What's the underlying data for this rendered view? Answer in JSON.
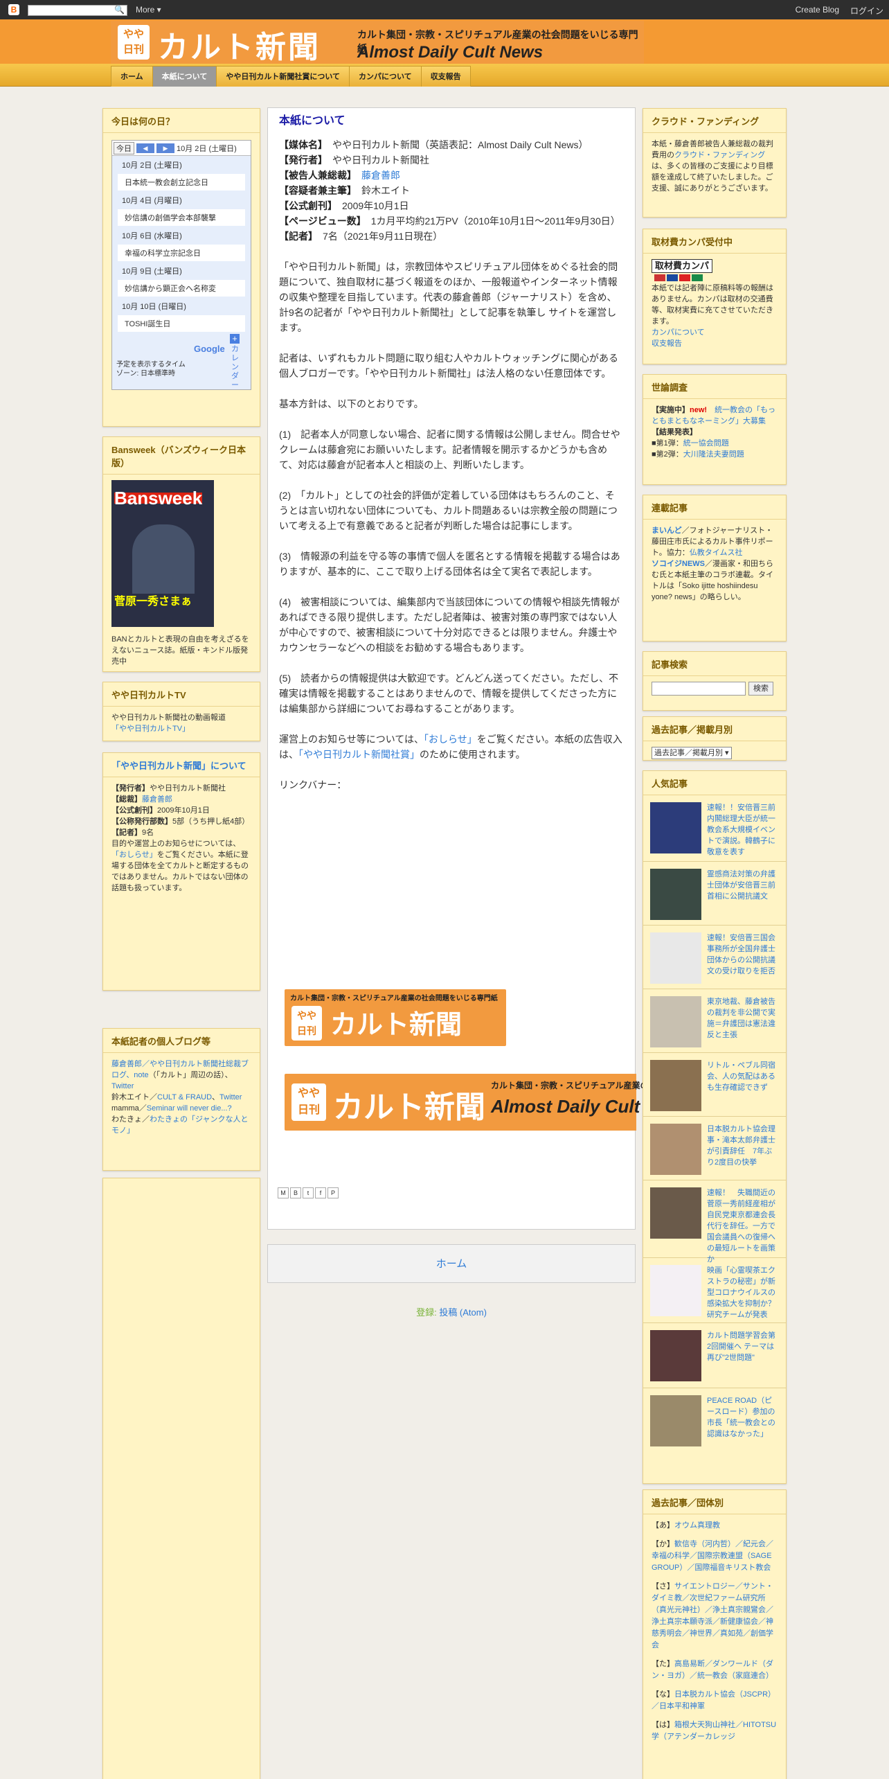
{
  "topbar": {
    "more_label": "More ▾",
    "create_blog": "Create Blog",
    "login": "ログイン"
  },
  "header": {
    "logo_yaya": "やや",
    "logo_nikkan": "日刊",
    "title": "カルト新聞",
    "subtitle": "カルト集団・宗教・スピリチュアル産業の社会問題をいじる専門紙",
    "english": "Almost Daily Cult News"
  },
  "tabs": [
    "ホーム",
    "本紙について",
    "やや日刊カルト新聞社賞について",
    "カンパについて",
    "収支報告"
  ],
  "left": {
    "today": {
      "title": "今日は何の日？",
      "today_btn": "今日",
      "date_label": "10月 2日 (土曜日)",
      "days": [
        {
          "d": "10月 2日 (土曜日)",
          "e": "日本統一教会創立記念日"
        },
        {
          "d": "10月 4日 (月曜日)",
          "e": "妙信講の創価学会本部襲撃"
        },
        {
          "d": "10月 6日 (水曜日)",
          "e": "幸福の科学立宗記念日"
        },
        {
          "d": "10月 9日 (土曜日)",
          "e": "妙信講から顕正会へ名称変"
        },
        {
          "d": "10月 10日 (日曜日)",
          "e": "TOSHI誕生日"
        }
      ],
      "google": "Google",
      "cal_label": "カレンダー",
      "tz1": "予定を表示するタイム",
      "tz2": "ゾーン: 日本標準時"
    },
    "bansweek": {
      "title": "Bansweek（バンズウィーク日本版）",
      "cover_title": "Bansweek",
      "cover_name": "菅原一秀さまぁ",
      "desc": "BANとカルトと表現の自由を考えざるをえないニュース誌。紙版・キンドル版発売中"
    },
    "tv": {
      "title": "やや日刊カルトTV",
      "desc": "やや日刊カルト新聞社の動画報道",
      "link": "「やや日刊カルトTV」"
    },
    "about": {
      "title": "「やや日刊カルト新聞」について",
      "rows": [
        [
          "【発行者】",
          "やや日刊カルト新聞社"
        ],
        [
          "【総裁】",
          "藤倉善郎"
        ],
        [
          "【公式創刊】",
          "2009年10月1日"
        ],
        [
          "【公称発行部数】",
          "5部（うち押し紙4部）"
        ],
        [
          "【記者】",
          "9名"
        ]
      ],
      "text1": "目的や運営上のお知らせについては、",
      "link": "「おしらせ」",
      "text2": "をご覧ください。本紙に登場する団体を全てカルトと断定するものではありません。カルトではない団体の話題も扱っています。"
    },
    "blogs": {
      "title": "本紙記者の個人ブログ等",
      "l1a": "藤倉善郎",
      "l1b": "／やや日刊カルト新聞社総裁ブログ、",
      "l1c": "note",
      "l1d": "（「カルト」周辺の話）、",
      "l1e": "Twitter",
      "l2a": "鈴木エイト／",
      "l2b": "CULT & FRAUD",
      "l2c": "、",
      "l2d": "Twitter",
      "l3a": "mamma／",
      "l3b": "Seminar will never die...?",
      "l4a": "わたきょ／",
      "l4b": "わたきょの「ジャンクな人とモノ」"
    }
  },
  "post": {
    "title": "本紙について",
    "fields": [
      [
        "【媒体名】",
        "やや日刊カルト新聞（英語表記：Almost Daily Cult News）"
      ],
      [
        "【発行者】",
        "やや日刊カルト新聞社"
      ],
      [
        "【被告人兼総裁】",
        "藤倉善郎"
      ],
      [
        "【容疑者兼主筆】",
        "鈴木エイト"
      ],
      [
        "【公式創刊】",
        "2009年10月1日"
      ],
      [
        "【ページビュー数】",
        "1カ月平均約21万PV（2010年10月1日～2011年9月30日）"
      ],
      [
        "【記者】",
        "7名（2021年9月11日現在）"
      ]
    ],
    "p1": "「やや日刊カルト新聞」は，宗教団体やスピリチュアル団体をめぐる社会的問題について、独自取材に基づく報道をのほか、一般報道やインターネット情報の収集や整理を目指しています。代表の藤倉善郎（ジャーナリスト）を含め、計9名の記者が「やや日刊カルト新聞社」として記事を執筆し サイトを運営します。",
    "p2": "記者は、いずれもカルト問題に取り組む人やカルトウォッチングに関心がある個人ブロガーです。「やや日刊カルト新聞社」は法人格のない任意団体です。",
    "p3": "基本方針は、以下のとおりです。",
    "p4": "(1)　記者本人が同意しない場合、記者に関する情報は公開しません。問合せやクレームは藤倉宛にお願いいたします。記者情報を開示するかどうかも含めて、対応は藤倉が記者本人と相談の上、判断いたします。",
    "p5": "(2)　「カルト」としての社会的評価が定着している団体はもちろんのこと、そうとは言い切れない団体についても、カルト問題あるいは宗教全般の問題について考える上で有意義であると記者が判断した場合は記事にします。",
    "p6": "(3)　情報源の利益を守る等の事情で個人を匿名とする情報を掲載する場合はありますが、基本的に、ここで取り上げる団体名は全て実名で表記します。",
    "p7": "(4)　被害相談については、編集部内で当該団体についての情報や相談先情報があればできる限り提供します。ただし記者陣は、被害対策の専門家ではない人が中心ですので、被害相談について十分対応できるとは限りません。弁護士やカウンセラーなどへの相談をお勧めする場合もあります。",
    "p8": "(5)　読者からの情報提供は大歓迎です。どんどん送ってください。ただし、不確実は情報を掲載することはありませんので、情報を提供してくださった方には編集部から詳細についてお尋ねすることがあります。",
    "p9a": "運営上のお知らせ等については、",
    "p9b": "「おしらせ」",
    "p9c": "をご覧ください。本紙の広告収入は、",
    "p9d": "「やや日刊カルト新聞社賞」",
    "p9e": "のために使用されます。",
    "linkbanner": "リンクバナー：",
    "home": "ホーム",
    "subscribe": "登録:",
    "atom": "投稿 (Atom)"
  },
  "right": {
    "cf": {
      "title": "クラウド・ファンディング",
      "t1": "本紙・藤倉善郎被告人兼総裁の裁判費用の",
      "link": "クラウド・ファンディング",
      "t2": "は、多くの皆様のご支援により目標額を達成して終了いたしました。ご支援、誠にありがとうございます。"
    },
    "kanpa": {
      "title": "取材費カンパ受付中",
      "img": "取材費カンパ",
      "t1": "本紙では記者陣に原稿料等の報酬はありません。カンパは取材の交通費等、取材実費に充てさせていただきます。",
      "l1": "カンパについて",
      "l2": "収支報告"
    },
    "poll": {
      "title": "世論調査",
      "now": "【実施中】",
      "new": "new!",
      "nowlink": "統一教会の「もっともまともなネーミング」大募集",
      "res": "【結果発表】",
      "r1a": "■第1弾：",
      "r1b": "統一協会問題",
      "r2a": "■第2弾：",
      "r2b": "大川隆法夫妻問題"
    },
    "serial": {
      "title": "連載記事",
      "a1": "まいんど",
      "a2": "／フォトジャーナリスト・藤田庄市氏によるカルト事件リポート。協力：",
      "a3": "仏教タイムス社",
      "b1": "ソコイジNEWS",
      "b2": "／漫画家・和田ちらむ氏と本紙主筆のコラボ連載。タイトルは「Soko ijitte hoshiindesu yone? news」の略らしい。"
    },
    "search": {
      "title": "記事検索",
      "btn": "検索"
    },
    "archive": {
      "title": "過去記事／掲載月別",
      "select": "過去記事／掲載月別"
    },
    "popular": {
      "title": "人気記事",
      "items": [
        "速報！！安倍晋三前内閣総理大臣が統一教会系大規模イベントで演説。韓鶴子に敬意を表す",
        "霊感商法対策の弁護士団体が安倍晋三前首相に公開抗議文",
        "速報！安倍晋三国会事務所が全国弁護士団体からの公開抗議文の受け取りを拒否",
        "東京地裁、藤倉被告の裁判を非公開で実施＝弁護団は憲法違反と主張",
        "リトル・ペブル同宿会、人の気配はあるも生存確認できず",
        "日本脱カルト協会理事・滝本太郎弁護士が引責辞任　7年ぶり2度目の快挙",
        "速報！　失職間近の菅原一秀前経産相が自民党東京都連会長代行を辞任。一方で国会議員への復帰への最短ルートを画策か",
        "映画「心霊喫茶エクストラの秘密」が新型コロナウイルスの感染拡大を抑制か？　研究チームが発表",
        "カルト問題学習会第2回開催へ テーマは再び\"2世問題\"",
        "PEACE ROAD（ピースロード）参加の市長「統一教会との認識はなかった」"
      ]
    },
    "groups": {
      "title": "過去記事／団体別",
      "g1a": "【あ】",
      "g1b": "オウム真理教",
      "g2a": "【か】",
      "g2b": "歓信寺（河内哲）／紀元会／幸福の科学／国際宗教連盟（SAGE GROUP）／国際福音キリスト教会",
      "g3a": "【さ】",
      "g3b": "サイエントロジー／サント・ダイミ教／次世紀ファーム研究所（真光元神社）／浄土真宗親鸞会／浄土真宗本願寺派／新健康協会／神慈秀明会／神世界／真如苑／創価学会",
      "g4a": "【た】",
      "g4b": "高島易断／ダンワールド（ダン・ヨガ）／統一教会（家庭連合）",
      "g5a": "【な】",
      "g5b": "日本脱カルト協会（JSCPR）／日本平和神軍",
      "g6a": "【は】",
      "g6b": "箱根大天狗山神社／HITOTSU学（アテンダーカレッジ"
    }
  }
}
